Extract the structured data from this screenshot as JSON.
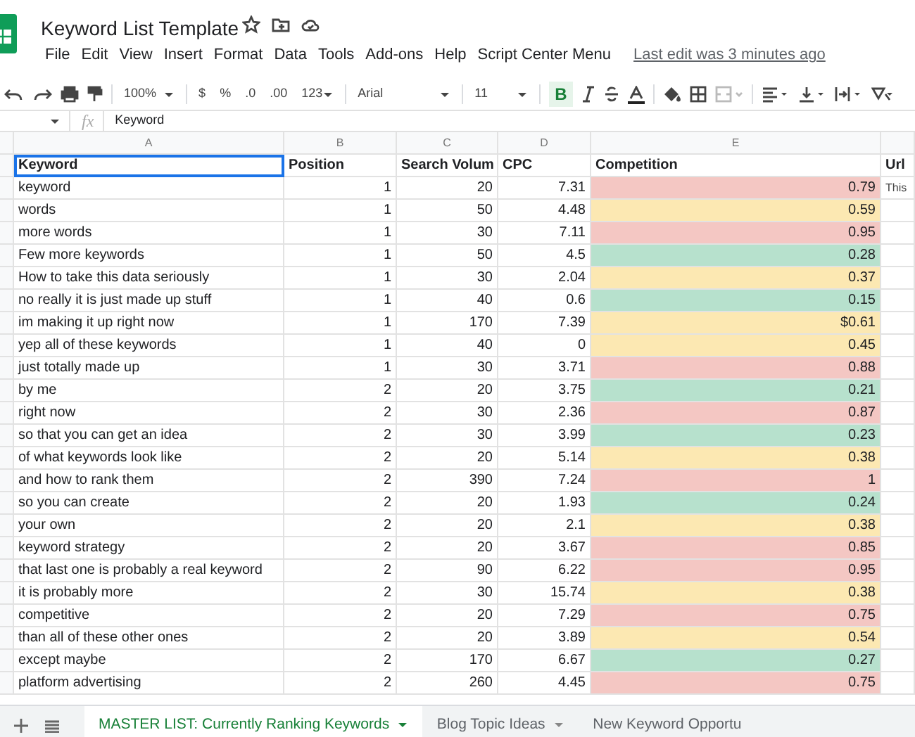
{
  "app": {
    "title": "Keyword List Template",
    "menu": [
      "File",
      "Edit",
      "View",
      "Insert",
      "Format",
      "Data",
      "Tools",
      "Add-ons",
      "Help",
      "Script Center Menu"
    ],
    "last_edit": "Last edit was 3 minutes ago"
  },
  "toolbar": {
    "zoom": "100%",
    "currency": "$",
    "percent": "%",
    "decrease_decimals": ".0",
    "increase_decimals": ".00",
    "more_formats": "123",
    "font": "Arial",
    "font_size": "11",
    "bold": "B",
    "bold_on": true
  },
  "formula_bar": {
    "fx": "fx",
    "value": "Keyword"
  },
  "sheet": {
    "column_letters": [
      "A",
      "B",
      "C",
      "D",
      "E"
    ],
    "header": [
      {
        "text": "Keyword",
        "selected": true
      },
      {
        "text": "Position",
        "selected": false
      },
      {
        "text": "Search Volum",
        "selected": false
      },
      {
        "text": "CPC",
        "selected": false
      },
      {
        "text": "Competition",
        "selected": false
      },
      {
        "text": "Url",
        "selected": false
      }
    ],
    "rows": [
      {
        "cells": [
          "keyword",
          "1",
          "20",
          "7.31",
          "0.79"
        ],
        "color": "#f4c7c3",
        "url": "This"
      },
      {
        "cells": [
          "words",
          "1",
          "50",
          "4.48",
          "0.59"
        ],
        "color": "#fce8b2"
      },
      {
        "cells": [
          "more words",
          "1",
          "30",
          "7.11",
          "0.95"
        ],
        "color": "#f4c7c3"
      },
      {
        "cells": [
          "Few more keywords",
          "1",
          "50",
          "4.5",
          "0.28"
        ],
        "color": "#b7e1cd"
      },
      {
        "cells": [
          "How to take this data seriously",
          "1",
          "30",
          "2.04",
          "0.37"
        ],
        "color": "#fce8b2"
      },
      {
        "cells": [
          "no really it is just made up stuff",
          "1",
          "40",
          "0.6",
          "0.15"
        ],
        "color": "#b7e1cd"
      },
      {
        "cells": [
          "im making it up right now",
          "1",
          "170",
          "7.39",
          "$0.61"
        ],
        "color": "#fce8b2"
      },
      {
        "cells": [
          "yep all of these keywords",
          "1",
          "40",
          "0",
          "0.45"
        ],
        "color": "#fce8b2"
      },
      {
        "cells": [
          "just totally made up",
          "1",
          "30",
          "3.71",
          "0.88"
        ],
        "color": "#f4c7c3"
      },
      {
        "cells": [
          "by me",
          "2",
          "20",
          "3.75",
          "0.21"
        ],
        "color": "#b7e1cd"
      },
      {
        "cells": [
          "right now",
          "2",
          "30",
          "2.36",
          "0.87"
        ],
        "color": "#f4c7c3"
      },
      {
        "cells": [
          "so that you can get an idea",
          "2",
          "30",
          "3.99",
          "0.23"
        ],
        "color": "#b7e1cd"
      },
      {
        "cells": [
          "of what keywords look like",
          "2",
          "20",
          "5.14",
          "0.38"
        ],
        "color": "#fce8b2"
      },
      {
        "cells": [
          "and how to rank them",
          "2",
          "390",
          "7.24",
          "1"
        ],
        "color": "#f4c7c3"
      },
      {
        "cells": [
          "so you can create",
          "2",
          "20",
          "1.93",
          "0.24"
        ],
        "color": "#b7e1cd"
      },
      {
        "cells": [
          "your own",
          "2",
          "20",
          "2.1",
          "0.38"
        ],
        "color": "#fce8b2"
      },
      {
        "cells": [
          "keyword strategy",
          "2",
          "20",
          "3.67",
          "0.85"
        ],
        "color": "#f4c7c3"
      },
      {
        "cells": [
          "that last one is probably a real keyword",
          "2",
          "90",
          "6.22",
          "0.95"
        ],
        "color": "#f4c7c3"
      },
      {
        "cells": [
          "it is probably more",
          "2",
          "30",
          "15.74",
          "0.38"
        ],
        "color": "#fce8b2"
      },
      {
        "cells": [
          "competitive",
          "2",
          "20",
          "7.29",
          "0.75"
        ],
        "color": "#f4c7c3"
      },
      {
        "cells": [
          "than all of these other ones",
          "2",
          "20",
          "3.89",
          "0.54"
        ],
        "color": "#fce8b2"
      },
      {
        "cells": [
          "except maybe",
          "2",
          "170",
          "6.67",
          "0.27"
        ],
        "color": "#b7e1cd"
      },
      {
        "cells": [
          "platform advertising",
          "2",
          "260",
          "4.45",
          "0.75"
        ],
        "color": "#f4c7c3"
      }
    ]
  },
  "sheet_tabs": [
    {
      "label": "MASTER LIST: Currently Ranking Keywords",
      "selected": true
    },
    {
      "label": "Blog Topic Ideas",
      "selected": false
    },
    {
      "label": "New Keyword Opportu",
      "selected": false
    }
  ]
}
